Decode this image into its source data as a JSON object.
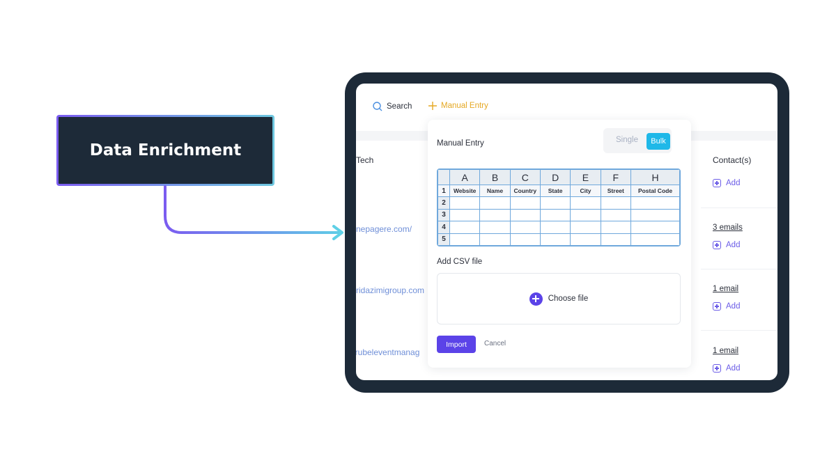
{
  "label": {
    "text": "Data Enrichment"
  },
  "nav": {
    "cut_text": "s",
    "search_label": "Search",
    "manual_label": "Manual Entry"
  },
  "table": {
    "col_tech": "Tech",
    "col_contacts": "Contact(s)",
    "rows": [
      {
        "link": "",
        "emails": "",
        "add": "Add"
      },
      {
        "link": "nepagere.com/",
        "emails": "3 emails",
        "add": "Add"
      },
      {
        "link": "ridazimigroup.com",
        "emails": "1 email",
        "add": "Add"
      },
      {
        "link": "/.rubeleventmanag",
        "emails": "1 email",
        "add": "Add"
      }
    ]
  },
  "modal": {
    "title": "Manual Entry",
    "toggle_single": "Single",
    "toggle_bulk": "Bulk",
    "sheet": {
      "columns": [
        "A",
        "B",
        "C",
        "D",
        "E",
        "F",
        "H"
      ],
      "fields": [
        "Website",
        "Name",
        "Country",
        "State",
        "City",
        "Street",
        "Postal  Code"
      ],
      "row_numbers": [
        "1",
        "2",
        "3",
        "4",
        "5"
      ]
    },
    "csv_label": "Add CSV file",
    "choose_file": "Choose file",
    "import_label": "Import",
    "cancel_label": "Cancel"
  },
  "colors": {
    "frame": "#1d2a38",
    "accent": "#5b43e8",
    "bulk": "#1fb8e8",
    "manual_entry": "#e5a823"
  }
}
